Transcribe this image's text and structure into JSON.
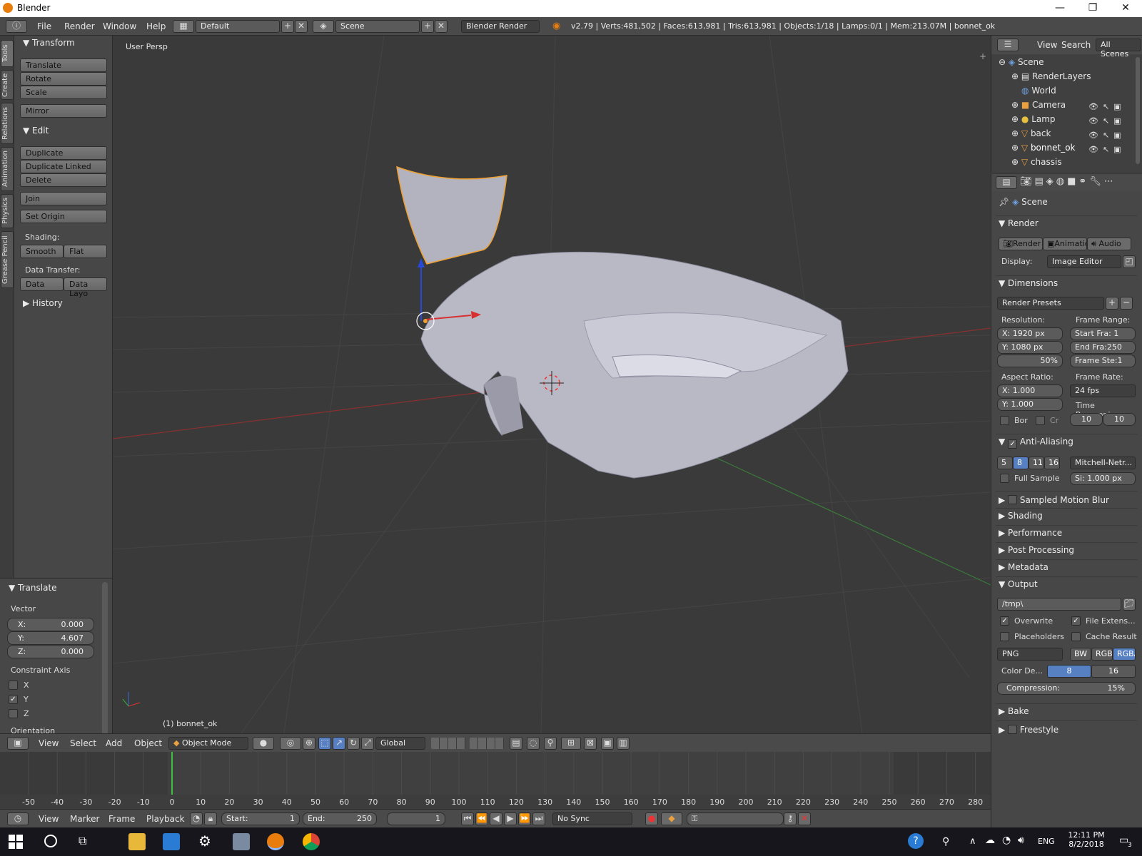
{
  "window": {
    "title": "Blender",
    "min": "—",
    "max": "❐",
    "close": "✕"
  },
  "infobar": {
    "menus": [
      "File",
      "Render",
      "Window",
      "Help"
    ],
    "layout": "Default",
    "scene": "Scene",
    "engine": "Blender Render",
    "stats": "v2.79 | Verts:481,502 | Faces:613,981 | Tris:613,981 | Objects:1/18 | Lamps:0/1 | Mem:213.07M | bonnet_ok"
  },
  "tabs": [
    "Tools",
    "Create",
    "Relations",
    "Animation",
    "Physics",
    "Grease Pencil"
  ],
  "toolshelf": {
    "transform": {
      "title": "Transform",
      "buttons": [
        "Translate",
        "Rotate",
        "Scale"
      ],
      "mirror": "Mirror"
    },
    "edit": {
      "title": "Edit",
      "buttons": [
        "Duplicate",
        "Duplicate Linked",
        "Delete"
      ],
      "join": "Join",
      "set_origin": "Set Origin"
    },
    "shading_label": "Shading:",
    "shading": [
      "Smooth",
      "Flat"
    ],
    "transfer_label": "Data Transfer:",
    "transfer": [
      "Data",
      "Data Layo"
    ],
    "history": "History"
  },
  "redo": {
    "title": "Translate",
    "vector_label": "Vector",
    "x": "X:",
    "x_val": "0.000",
    "y": "Y:",
    "y_val": "4.607",
    "z": "Z:",
    "z_val": "0.000",
    "constraint_label": "Constraint Axis",
    "axes": [
      "X",
      "Y",
      "Z"
    ],
    "orientation": "Orientation"
  },
  "viewport": {
    "view_name": "User Persp",
    "object_label": "(1) bonnet_ok"
  },
  "viewport_hdr": {
    "menus": [
      "View",
      "Select",
      "Add",
      "Object"
    ],
    "mode": "Object Mode",
    "orientation": "Global"
  },
  "timeline": {
    "ticks": [
      "-50",
      "-40",
      "-30",
      "-20",
      "-10",
      "0",
      "10",
      "20",
      "30",
      "40",
      "50",
      "60",
      "70",
      "80",
      "90",
      "100",
      "110",
      "120",
      "130",
      "140",
      "150",
      "160",
      "170",
      "180",
      "190",
      "200",
      "210",
      "220",
      "230",
      "240",
      "250",
      "260",
      "270",
      "280"
    ],
    "menus": [
      "View",
      "Marker",
      "Frame",
      "Playback"
    ],
    "start_label": "Start:",
    "start": "1",
    "end_label": "End:",
    "end": "250",
    "current": "1",
    "sync": "No Sync",
    "current_frame": 0
  },
  "outliner": {
    "menus": [
      "View",
      "Search"
    ],
    "filter": "All Scenes",
    "items": [
      "Scene",
      "RenderLayers",
      "World",
      "Camera",
      "Lamp",
      "back",
      "bonnet_ok",
      "chassis"
    ]
  },
  "props": {
    "context": "Scene",
    "render_title": "Render",
    "render_buttons": [
      "Render",
      "Animatio",
      "Audio"
    ],
    "display_label": "Display:",
    "display": "Image Editor",
    "dimensions_title": "Dimensions",
    "presets": "Render Presets",
    "resolution_label": "Resolution:",
    "res_x": "X:  1920 px",
    "res_y": "Y:  1080 px",
    "res_pct": "50%",
    "frame_range_label": "Frame Range:",
    "start_fra": "Start Fra:  1",
    "end_fra": "End Fra:250",
    "frame_step": "Frame Ste:1",
    "aspect_label": "Aspect Ratio:",
    "aspect_x": "X:      1.000",
    "aspect_y": "Y:      1.000",
    "frame_rate_label": "Frame Rate:",
    "frame_rate": "24 fps",
    "time_remap_label": "Time Remapping:",
    "remap_old": "10",
    "remap_new": "10",
    "bor": "Bor",
    "cr": "Cr",
    "aa_title": "Anti-Aliasing",
    "aa_levels": [
      "5",
      "8",
      "11",
      "16"
    ],
    "aa_filter": "Mitchell-Netr...",
    "full_sample": "Full Sample",
    "aa_size": "Si: 1.000 px",
    "collapsed": [
      "Sampled Motion Blur",
      "Shading",
      "Performance",
      "Post Processing",
      "Metadata"
    ],
    "output_title": "Output",
    "output_path": "/tmp\\",
    "overwrite": "Overwrite",
    "file_ext": "File Extens...",
    "placeholders": "Placeholders",
    "cache": "Cache Result",
    "format": "PNG",
    "color_modes": [
      "BW",
      "RGB",
      "RGBA"
    ],
    "color_depth_label": "Color De...",
    "depth8": "8",
    "depth16": "16",
    "compression": "Compression:",
    "compression_val": "15%",
    "bake": "Bake",
    "freestyle": "Freestyle"
  },
  "taskbar": {
    "lang": "ENG",
    "time": "12:11 PM",
    "date": "8/2/2018",
    "notif": "3"
  },
  "colors": {
    "accent": "#5680c2",
    "orange": "#e87d0d",
    "selection_outline": "#f0a030"
  }
}
